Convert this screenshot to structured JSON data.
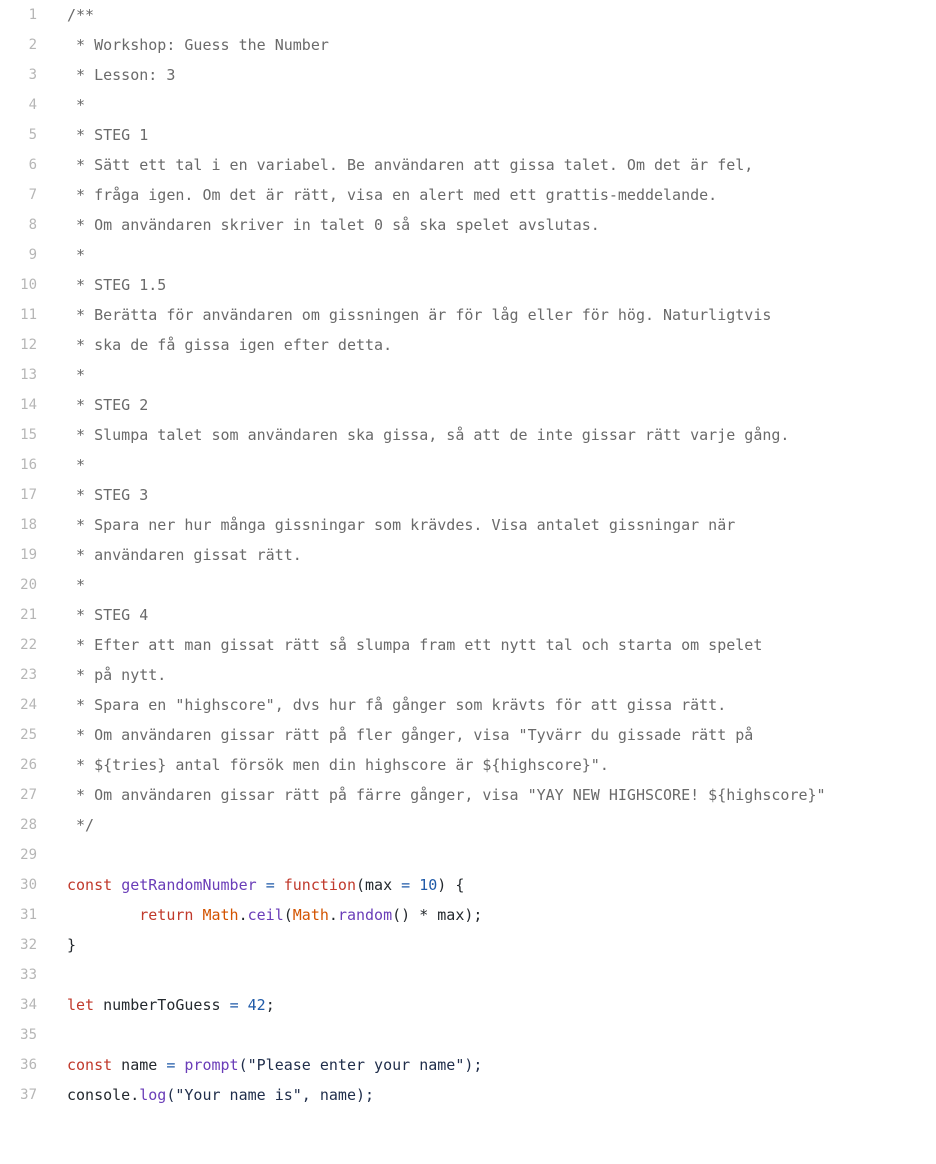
{
  "colors": {
    "comment": "#6a6a6a",
    "keyword": "#c0392b",
    "function": "#6a3db8",
    "number": "#1f5aa8",
    "builtin": "#d35400",
    "line_number": "#b6b6b6",
    "background": "#ffffff"
  },
  "lines": [
    {
      "n": "1",
      "tokens": [
        {
          "t": "/**",
          "c": "comment"
        }
      ]
    },
    {
      "n": "2",
      "tokens": [
        {
          "t": " * Workshop: Guess the Number",
          "c": "comment"
        }
      ]
    },
    {
      "n": "3",
      "tokens": [
        {
          "t": " * Lesson: 3",
          "c": "comment"
        }
      ]
    },
    {
      "n": "4",
      "tokens": [
        {
          "t": " *",
          "c": "comment"
        }
      ]
    },
    {
      "n": "5",
      "tokens": [
        {
          "t": " * STEG 1",
          "c": "comment"
        }
      ]
    },
    {
      "n": "6",
      "tokens": [
        {
          "t": " * Sätt ett tal i en variabel. Be användaren att gissa talet. Om det är fel,",
          "c": "comment"
        }
      ]
    },
    {
      "n": "7",
      "tokens": [
        {
          "t": " * fråga igen. Om det är rätt, visa en alert med ett grattis-meddelande.",
          "c": "comment"
        }
      ]
    },
    {
      "n": "8",
      "tokens": [
        {
          "t": " * Om användaren skriver in talet 0 så ska spelet avslutas.",
          "c": "comment"
        }
      ]
    },
    {
      "n": "9",
      "tokens": [
        {
          "t": " *",
          "c": "comment"
        }
      ]
    },
    {
      "n": "10",
      "tokens": [
        {
          "t": " * STEG 1.5",
          "c": "comment"
        }
      ]
    },
    {
      "n": "11",
      "tokens": [
        {
          "t": " * Berätta för användaren om gissningen är för låg eller för hög. Naturligtvis",
          "c": "comment"
        }
      ]
    },
    {
      "n": "12",
      "tokens": [
        {
          "t": " * ska de få gissa igen efter detta.",
          "c": "comment"
        }
      ]
    },
    {
      "n": "13",
      "tokens": [
        {
          "t": " *",
          "c": "comment"
        }
      ]
    },
    {
      "n": "14",
      "tokens": [
        {
          "t": " * STEG 2",
          "c": "comment"
        }
      ]
    },
    {
      "n": "15",
      "tokens": [
        {
          "t": " * Slumpa talet som användaren ska gissa, så att de inte gissar rätt varje gång.",
          "c": "comment"
        }
      ]
    },
    {
      "n": "16",
      "tokens": [
        {
          "t": " *",
          "c": "comment"
        }
      ]
    },
    {
      "n": "17",
      "tokens": [
        {
          "t": " * STEG 3",
          "c": "comment"
        }
      ]
    },
    {
      "n": "18",
      "tokens": [
        {
          "t": " * Spara ner hur många gissningar som krävdes. Visa antalet gissningar när",
          "c": "comment"
        }
      ]
    },
    {
      "n": "19",
      "tokens": [
        {
          "t": " * användaren gissat rätt.",
          "c": "comment"
        }
      ]
    },
    {
      "n": "20",
      "tokens": [
        {
          "t": " *",
          "c": "comment"
        }
      ]
    },
    {
      "n": "21",
      "tokens": [
        {
          "t": " * STEG 4",
          "c": "comment"
        }
      ]
    },
    {
      "n": "22",
      "tokens": [
        {
          "t": " * Efter att man gissat rätt så slumpa fram ett nytt tal och starta om spelet",
          "c": "comment"
        }
      ]
    },
    {
      "n": "23",
      "tokens": [
        {
          "t": " * på nytt.",
          "c": "comment"
        }
      ]
    },
    {
      "n": "24",
      "tokens": [
        {
          "t": " * Spara en \"highscore\", dvs hur få gånger som krävts för att gissa rätt.",
          "c": "comment"
        }
      ]
    },
    {
      "n": "25",
      "tokens": [
        {
          "t": " * Om användaren gissar rätt på fler gånger, visa \"Tyvärr du gissade rätt på",
          "c": "comment"
        }
      ]
    },
    {
      "n": "26",
      "tokens": [
        {
          "t": " * ${tries} antal försök men din highscore är ${highscore}\".",
          "c": "comment"
        }
      ]
    },
    {
      "n": "27",
      "tokens": [
        {
          "t": " * Om användaren gissar rätt på färre gånger, visa \"YAY NEW HIGHSCORE! ${highscore}\"",
          "c": "comment"
        }
      ]
    },
    {
      "n": "28",
      "tokens": [
        {
          "t": " */",
          "c": "comment"
        }
      ]
    },
    {
      "n": "29",
      "tokens": []
    },
    {
      "n": "30",
      "tokens": [
        {
          "t": "const",
          "c": "kw"
        },
        {
          "t": " ",
          "c": "plain"
        },
        {
          "t": "getRandomNumber",
          "c": "fn"
        },
        {
          "t": " ",
          "c": "plain"
        },
        {
          "t": "=",
          "c": "op"
        },
        {
          "t": " ",
          "c": "plain"
        },
        {
          "t": "function",
          "c": "kw"
        },
        {
          "t": "(max ",
          "c": "plain"
        },
        {
          "t": "=",
          "c": "op"
        },
        {
          "t": " ",
          "c": "plain"
        },
        {
          "t": "10",
          "c": "num"
        },
        {
          "t": ") {",
          "c": "plain"
        }
      ]
    },
    {
      "n": "31",
      "tokens": [
        {
          "t": "        ",
          "c": "plain"
        },
        {
          "t": "return",
          "c": "kw"
        },
        {
          "t": " ",
          "c": "plain"
        },
        {
          "t": "Math",
          "c": "builtin"
        },
        {
          "t": ".",
          "c": "plain"
        },
        {
          "t": "ceil",
          "c": "fn"
        },
        {
          "t": "(",
          "c": "plain"
        },
        {
          "t": "Math",
          "c": "builtin"
        },
        {
          "t": ".",
          "c": "plain"
        },
        {
          "t": "random",
          "c": "fn"
        },
        {
          "t": "() * max);",
          "c": "plain"
        }
      ]
    },
    {
      "n": "32",
      "tokens": [
        {
          "t": "}",
          "c": "plain"
        }
      ]
    },
    {
      "n": "33",
      "tokens": []
    },
    {
      "n": "34",
      "tokens": [
        {
          "t": "let",
          "c": "kw"
        },
        {
          "t": " numberToGuess ",
          "c": "plain"
        },
        {
          "t": "=",
          "c": "op"
        },
        {
          "t": " ",
          "c": "plain"
        },
        {
          "t": "42",
          "c": "num"
        },
        {
          "t": ";",
          "c": "plain"
        }
      ]
    },
    {
      "n": "35",
      "tokens": []
    },
    {
      "n": "36",
      "tokens": [
        {
          "t": "const",
          "c": "kw"
        },
        {
          "t": " name ",
          "c": "plain"
        },
        {
          "t": "=",
          "c": "op"
        },
        {
          "t": " ",
          "c": "plain"
        },
        {
          "t": "prompt",
          "c": "fn"
        },
        {
          "t": "(\"Please enter your name\");",
          "c": "str"
        }
      ]
    },
    {
      "n": "37",
      "tokens": [
        {
          "t": "console",
          "c": "plain"
        },
        {
          "t": ".",
          "c": "plain"
        },
        {
          "t": "log",
          "c": "fn"
        },
        {
          "t": "(\"Your name is\", name);",
          "c": "str"
        }
      ]
    }
  ]
}
